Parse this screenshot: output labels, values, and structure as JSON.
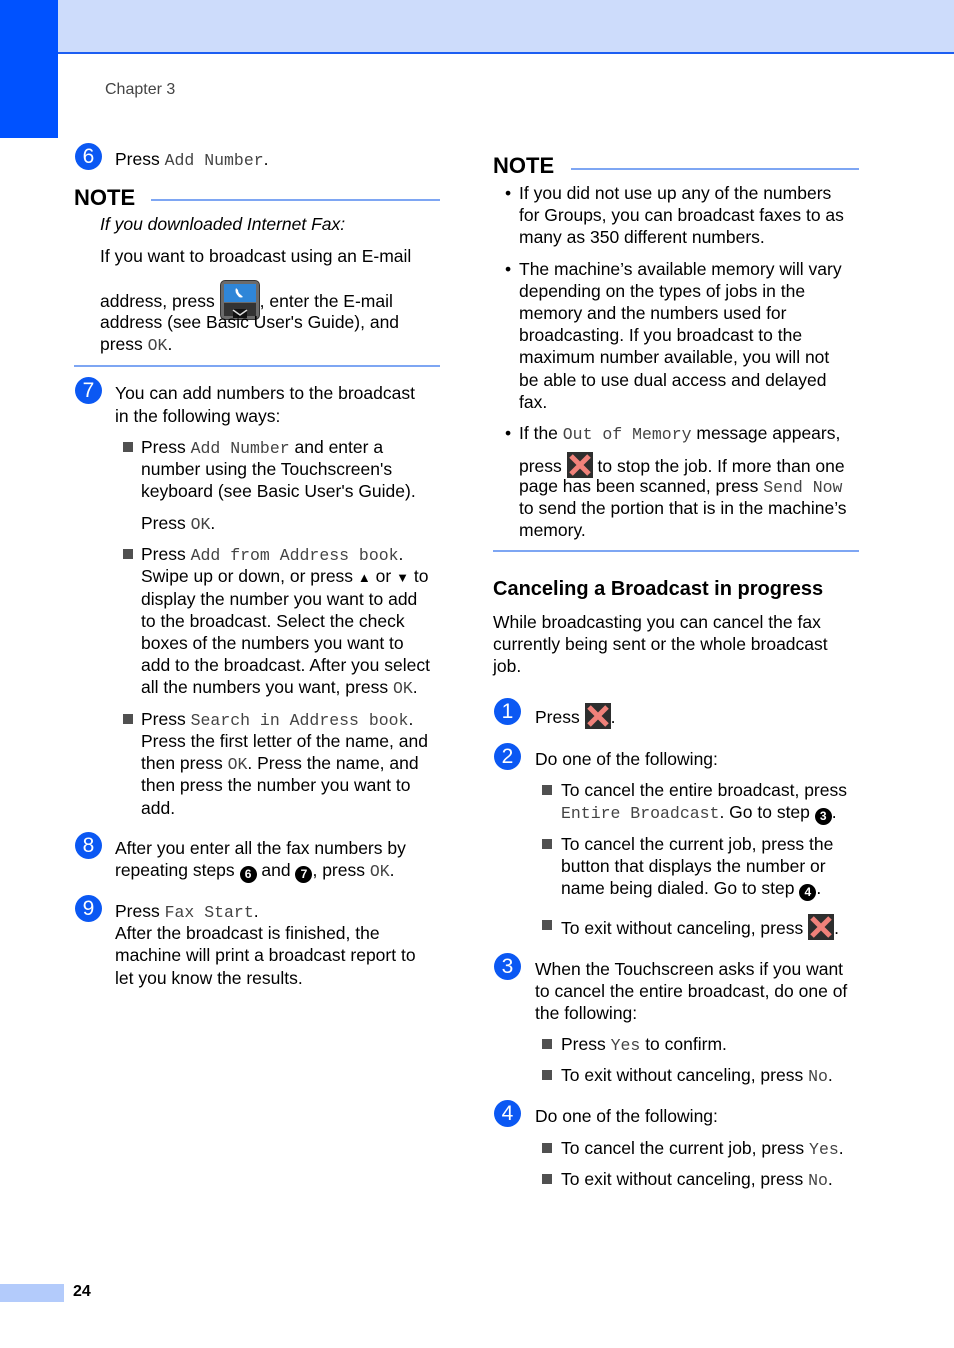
{
  "header": {
    "chapter": "Chapter 3"
  },
  "footer": {
    "page_number": "24"
  },
  "colors": {
    "accent_blue": "#0052ff",
    "band_light": "#cddcfb",
    "rule": "#7ea6f3",
    "cancel_x": "#f0817a"
  },
  "left": {
    "step6": {
      "num": "6",
      "pre": "Press ",
      "code": "Add Number",
      "post": "."
    },
    "note": {
      "title": "NOTE",
      "italic": "If you downloaded Internet Fax:",
      "line1": "If you want to broadcast using an E-mail",
      "line2_pre": "address, press ",
      "line2_post": ", enter the E-mail",
      "line3": "address (see Basic User's Guide), and",
      "line4_pre": "press ",
      "line4_code": "OK",
      "line4_post": ".",
      "icon": "phone-email-icon"
    },
    "step7": {
      "num": "7",
      "lines": [
        "You can add numbers to the broadcast",
        "in the following ways:"
      ],
      "b1": {
        "pre": "Press ",
        "code": "Add Number",
        "post": " and enter a",
        "lines": [
          "number using the Touchscreen's",
          "keyboard (see Basic User's Guide)."
        ],
        "press": "Press ",
        "press_code": "OK",
        "press_post": "."
      },
      "b2": {
        "pre": "Press ",
        "code": "Add from Address book",
        "post": ".",
        "l1_pre": "Swipe up or down, or press ",
        "up": "▲",
        "or": " or ",
        "down": "▼",
        "l1_post": " to",
        "lines": [
          "display the number you want to add",
          "to the broadcast. Select the check",
          "boxes of the numbers you want to",
          "add to the broadcast. After you select"
        ],
        "last_pre": "all the numbers you want, press ",
        "last_code": "OK",
        "last_post": "."
      },
      "b3": {
        "pre": "Press ",
        "code": "Search in Address book",
        "post": ".",
        "l1": "Press the first letter of the name, and",
        "l2_pre": "then press ",
        "l2_code": "OK",
        "l2_post": ". Press the name, and",
        "l3": "then press the number you want to",
        "l4": "add."
      }
    },
    "step8": {
      "num": "8",
      "l1": "After you enter all the fax numbers by",
      "l2_pre": "repeating steps ",
      "ref1": "6",
      "and": " and ",
      "ref2": "7",
      "l2_mid": ", press ",
      "code": "OK",
      "post": "."
    },
    "step9": {
      "num": "9",
      "pre": "Press ",
      "code": "Fax Start",
      "post": ".",
      "lines": [
        "After the broadcast is finished, the",
        "machine will print a broadcast report to",
        "let you know the results."
      ]
    }
  },
  "right": {
    "note": {
      "title": "NOTE",
      "b1": [
        "If you did not use up any of the numbers",
        "for Groups, you can broadcast faxes to as",
        "many as 350 different numbers."
      ],
      "b2": [
        "The machine’s available memory will vary",
        "depending on the types of jobs in the",
        "memory and the numbers used for",
        "broadcasting. If you broadcast to the",
        "maximum number available, you will not",
        "be able to use dual access and delayed",
        "fax."
      ],
      "b3": {
        "pre": "If the ",
        "code": "Out of Memory",
        "post": " message appears,",
        "l2_pre": "press ",
        "l2_post": " to stop the job. If more than one",
        "l3_pre": "page has been scanned, press ",
        "l3_code": "Send Now",
        "l4": "to send the portion that is in the machine’s",
        "l5": "memory."
      }
    },
    "section": {
      "title": "Canceling a Broadcast in progress",
      "intro": [
        "While broadcasting you can cancel the fax",
        "currently being sent or the whole broadcast",
        "job."
      ]
    },
    "step1": {
      "num": "1",
      "pre": "Press ",
      "post": "."
    },
    "step2": {
      "num": "2",
      "text": "Do one of the following:",
      "b1_l1": "To cancel the entire broadcast, press",
      "b1_code": "Entire Broadcast",
      "b1_post": ". Go to step ",
      "b1_ref": "3",
      "b1_end": ".",
      "b2": [
        "To cancel the current job, press the",
        "button that displays the number or"
      ],
      "b2_last": "name being dialed. Go to step ",
      "b2_ref": "4",
      "b2_end": ".",
      "b3_pre": "To exit without canceling, press ",
      "b3_post": "."
    },
    "step3": {
      "num": "3",
      "lines": [
        "When the Touchscreen asks if you want",
        "to cancel the entire broadcast, do one of",
        "the following:"
      ],
      "b1_pre": "Press ",
      "b1_code": "Yes",
      "b1_post": " to confirm.",
      "b2_pre": "To exit without canceling, press ",
      "b2_code": "No",
      "b2_post": "."
    },
    "step4": {
      "num": "4",
      "text": "Do one of the following:",
      "b1_pre": "To cancel the current job, press ",
      "b1_code": "Yes",
      "b1_post": ".",
      "b2_pre": "To exit without canceling, press ",
      "b2_code": "No",
      "b2_post": "."
    }
  }
}
